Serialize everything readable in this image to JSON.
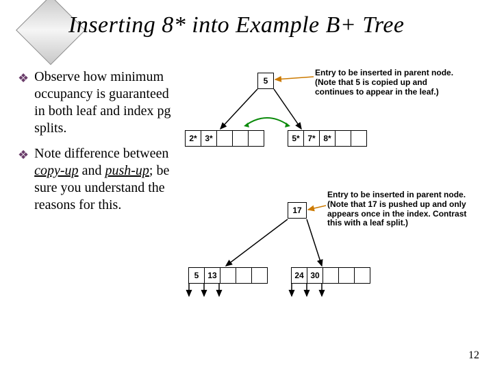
{
  "title": "Inserting 8* into Example B+ Tree",
  "bullets": {
    "b1_pre": "Observe how minimum occupancy is guaranteed in both leaf and index pg splits.",
    "b2_pre": "Note difference between ",
    "b2_copyup": "copy-up",
    "b2_mid": " and ",
    "b2_pushup": "push-up",
    "b2_post": "; be sure you understand the reasons for this."
  },
  "notes": {
    "leaf_split": "Entry to be inserted in parent node. (Note that 5 is copied up and continues to appear in the leaf.)",
    "index_split": "Entry to be inserted in parent node. (Note that 17 is pushed up and only appears once in the index. Contrast this with a leaf split.)"
  },
  "nodes": {
    "top5": "5",
    "leaf_left_0": "2*",
    "leaf_left_1": "3*",
    "leaf_right_0": "5*",
    "leaf_right_1": "7*",
    "leaf_right_2": "8*",
    "mid17": "17",
    "idx_left_0": "5",
    "idx_left_1": "13",
    "idx_right_0": "24",
    "idx_right_1": "30"
  },
  "page_number": "12"
}
